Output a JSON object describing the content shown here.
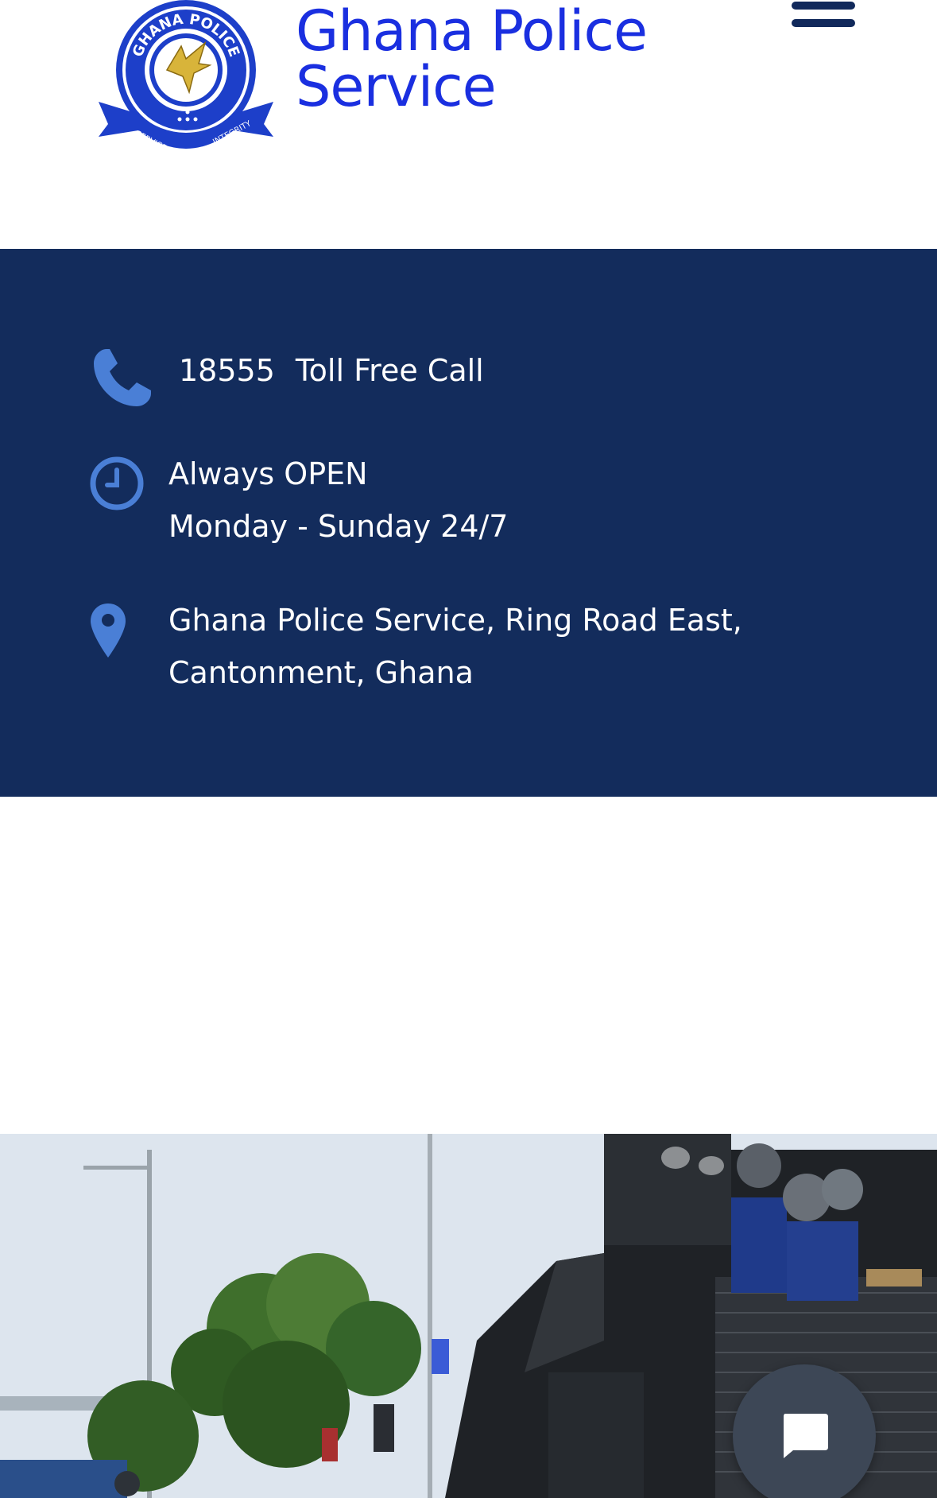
{
  "header": {
    "title_line1": "Ghana Police",
    "title_line2": "Service",
    "logo": {
      "ring_text_top": "GHANA POLICE",
      "ribbon_left": "SERVICE",
      "ribbon_mid": "WITH",
      "ribbon_right": "INTEGRITY"
    },
    "menu_icon": "hamburger-menu-icon"
  },
  "contact": {
    "phone_number": "18555",
    "phone_label": "Toll Free Call",
    "hours_line1": "Always OPEN",
    "hours_line2": "Monday - Sunday 24/7",
    "address_line1": "Ghana Police Service, Ring Road East,",
    "address_line2": "Cantonment, Ghana",
    "icons": [
      "phone-icon",
      "clock-icon",
      "map-pin-icon"
    ]
  },
  "chat": {
    "icon": "chat-bubble-icon"
  },
  "colors": {
    "brand_blue": "#1a2fe0",
    "navy_band": "#132c5c",
    "icon_blue": "#4a7fd6",
    "chat_button": "#3d4756"
  }
}
